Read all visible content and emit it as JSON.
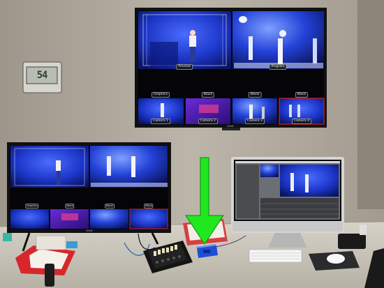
{
  "scene": {
    "colors": {
      "wall": "#b4ada1",
      "desk": "#c8c3b8",
      "stage_blue": "#1d3bd6",
      "arrow_green": "#1fe81f"
    }
  },
  "clock": {
    "reading": "54"
  },
  "big_multiview": {
    "brand": "SONY",
    "preview_label": "Preview",
    "program_label": "Program",
    "row_labels": [
      "Graphics",
      "Black",
      "Blank",
      "Black"
    ],
    "camera_labels": [
      "Camera 1",
      "Camera 2",
      "Camera 3",
      "Camera 4"
    ]
  },
  "small_multiview": {
    "brand": "SONY",
    "row_labels": [
      "Graphics",
      "Black",
      "Blank",
      "Black"
    ]
  },
  "imac": {
    "brand": ""
  },
  "annotation": {
    "arrow_target": "control-box"
  }
}
